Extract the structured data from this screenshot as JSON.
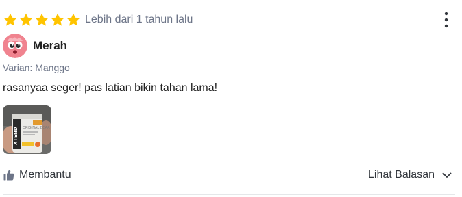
{
  "review": {
    "rating": 5,
    "rating_max": 5,
    "time_text": "Lebih dari 1 tahun lalu",
    "username": "Merah",
    "variant": "Varian: Manggo",
    "text": "rasanyaa seger! pas latian bikin tahan lama!",
    "helpful_label": "Membantu",
    "replies_label": "Lihat Balasan",
    "photo_brand_text": "XTEND",
    "photo_product_text": "ORIGINAL BCAA",
    "colors": {
      "star": "#ffc400",
      "muted_text": "#6d7588",
      "body_text": "#212121",
      "action_text": "#31353b",
      "thumb_icon": "#6d7588",
      "avatar_bg": "#f0838f"
    }
  }
}
